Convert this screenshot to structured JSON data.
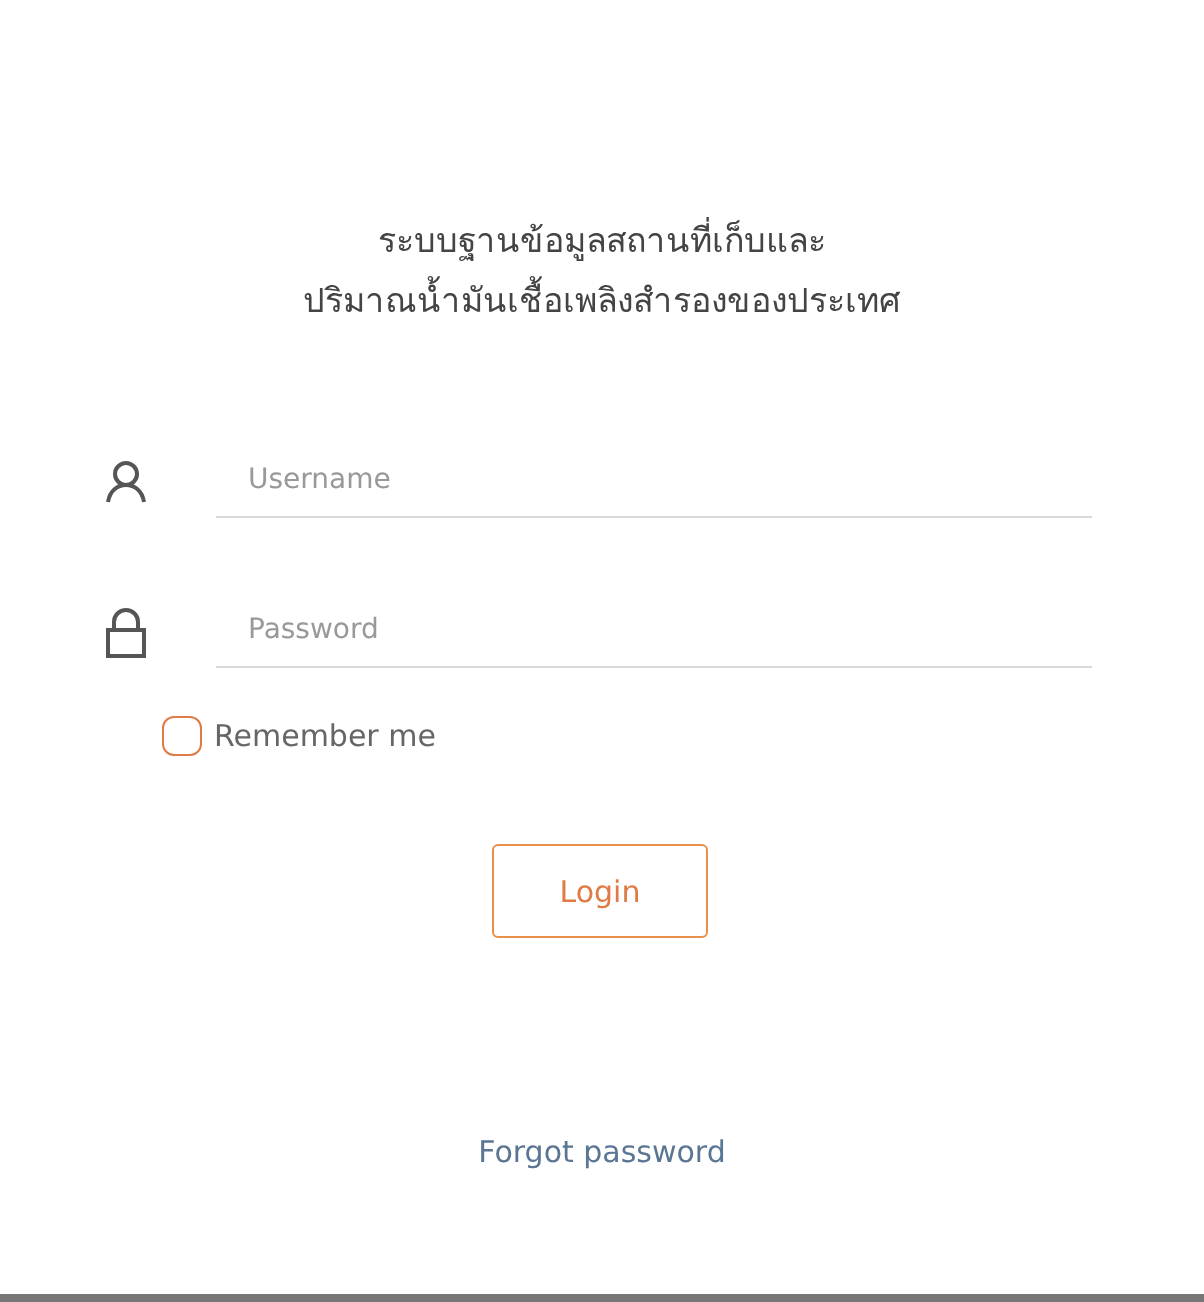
{
  "title_lines": [
    "ระบบฐานข้อมูลสถานที่เก็บและ",
    "ปริมาณน้ำมันเชื้อเพลิงสำรองของประเทศ"
  ],
  "fields": [
    {
      "kind": "user",
      "placeholder": "Username"
    },
    {
      "kind": "lock",
      "placeholder": "Password"
    }
  ],
  "remember": {
    "label": "Remember me",
    "checked": false
  },
  "login_button": "Login",
  "forgot_link": "Forgot password"
}
